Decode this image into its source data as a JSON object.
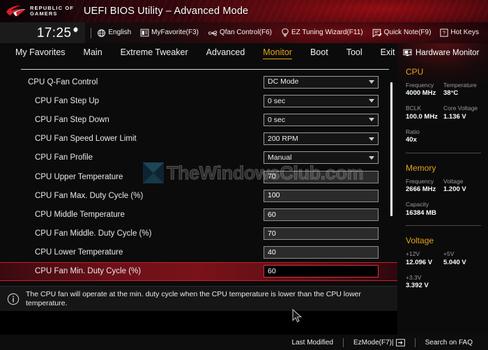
{
  "titlebar": {
    "brand_line1": "REPUBLIC OF",
    "brand_line2": "GAMERS",
    "logo_icon": "rog-eye-logo",
    "title": "UEFI BIOS Utility – Advanced Mode"
  },
  "toolbar": {
    "time": "17:25",
    "gear_icon": "gear-icon",
    "items": [
      {
        "label": "English",
        "icon": "globe-icon"
      },
      {
        "label": "MyFavorite(F3)",
        "icon": "list-icon"
      },
      {
        "label": "Qfan Control(F6)",
        "icon": "fan-icon"
      },
      {
        "label": "EZ Tuning Wizard(F11)",
        "icon": "bulb-icon"
      },
      {
        "label": "Quick Note(F9)",
        "icon": "note-icon"
      },
      {
        "label": "Hot Keys",
        "icon": "question-key-icon"
      }
    ]
  },
  "nav": {
    "tabs": [
      {
        "label": "My Favorites",
        "active": false
      },
      {
        "label": "Main",
        "active": false
      },
      {
        "label": "Extreme Tweaker",
        "active": false
      },
      {
        "label": "Advanced",
        "active": false
      },
      {
        "label": "Monitor",
        "active": true
      },
      {
        "label": "Boot",
        "active": false
      },
      {
        "label": "Tool",
        "active": false
      },
      {
        "label": "Exit",
        "active": false
      }
    ],
    "active_color": "#e5a21c"
  },
  "settings": {
    "rows": [
      {
        "label": "CPU Q-Fan Control",
        "value": "DC Mode",
        "type": "dropdown",
        "indent": 0,
        "selected": false
      },
      {
        "label": "CPU Fan Step Up",
        "value": "0 sec",
        "type": "dropdown",
        "indent": 1,
        "selected": false
      },
      {
        "label": "CPU Fan Step Down",
        "value": "0 sec",
        "type": "dropdown",
        "indent": 1,
        "selected": false
      },
      {
        "label": "CPU Fan Speed Lower Limit",
        "value": "200 RPM",
        "type": "dropdown",
        "indent": 1,
        "selected": false
      },
      {
        "label": "CPU Fan Profile",
        "value": "Manual",
        "type": "dropdown",
        "indent": 1,
        "selected": false
      },
      {
        "label": "CPU Upper Temperature",
        "value": "70",
        "type": "text",
        "indent": 1,
        "selected": false
      },
      {
        "label": "CPU Fan Max. Duty Cycle (%)",
        "value": "100",
        "type": "text",
        "indent": 1,
        "selected": false
      },
      {
        "label": "CPU Middle Temperature",
        "value": "60",
        "type": "text",
        "indent": 1,
        "selected": false
      },
      {
        "label": "CPU Fan Middle. Duty Cycle (%)",
        "value": "70",
        "type": "text",
        "indent": 1,
        "selected": false
      },
      {
        "label": "CPU Lower Temperature",
        "value": "40",
        "type": "text",
        "indent": 1,
        "selected": false
      },
      {
        "label": "CPU Fan Min. Duty Cycle (%)",
        "value": "60",
        "type": "text",
        "indent": 1,
        "selected": true
      }
    ],
    "selected_row_color": "#7a1219"
  },
  "help": {
    "icon": "info-icon",
    "text": "The CPU fan will operate at the min. duty cycle when the CPU temperature is lower than the CPU lower temperature."
  },
  "hardware_monitor": {
    "header": "Hardware Monitor",
    "header_icon": "monitor-icon",
    "section_color": "#e5a21c",
    "sections": [
      {
        "title": "CPU",
        "items": [
          {
            "key": "Frequency",
            "value": "4000 MHz",
            "full": false
          },
          {
            "key": "Temperature",
            "value": "38°C",
            "full": false
          },
          {
            "key": "BCLK",
            "value": "100.0 MHz",
            "full": false
          },
          {
            "key": "Core Voltage",
            "value": "1.136 V",
            "full": false
          },
          {
            "key": "Ratio",
            "value": "40x",
            "full": true
          }
        ]
      },
      {
        "title": "Memory",
        "items": [
          {
            "key": "Frequency",
            "value": "2666 MHz",
            "full": false
          },
          {
            "key": "Voltage",
            "value": "1.200 V",
            "full": false
          },
          {
            "key": "Capacity",
            "value": "16384 MB",
            "full": true
          }
        ]
      },
      {
        "title": "Voltage",
        "items": [
          {
            "key": "+12V",
            "value": "12.096 V",
            "full": false
          },
          {
            "key": "+5V",
            "value": "5.040 V",
            "full": false
          },
          {
            "key": "+3.3V",
            "value": "3.392 V",
            "full": true
          }
        ]
      }
    ]
  },
  "footer": {
    "items": [
      {
        "label": "Last Modified",
        "icon": ""
      },
      {
        "label": "EzMode(F7)|",
        "icon": "arrow-right-box-icon"
      },
      {
        "label": "Search on FAQ",
        "icon": ""
      }
    ]
  },
  "watermark": {
    "text": "TheWindowsClub.com",
    "logo_icon": "x-logo-icon"
  },
  "cursor": {
    "icon": "mouse-pointer-icon"
  }
}
